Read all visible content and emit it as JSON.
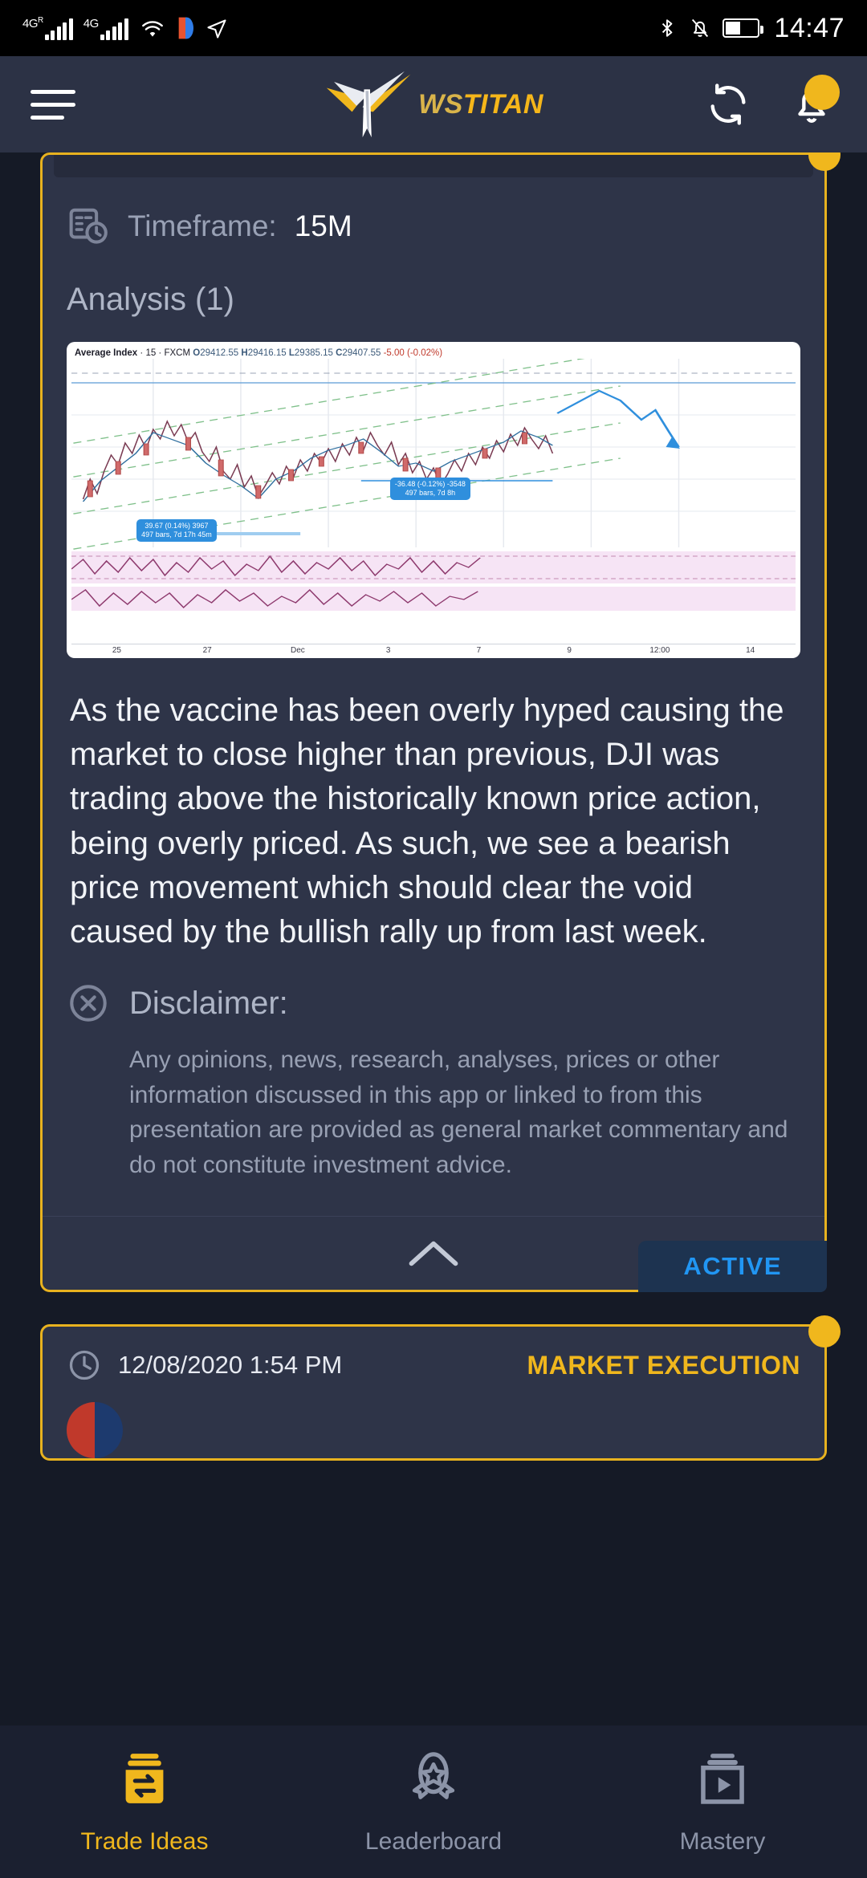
{
  "statusbar": {
    "network_primary": "4G",
    "network_primary_sup": "R",
    "network_secondary": "4G",
    "icons": [
      "wifi-icon",
      "app-icon",
      "location-icon",
      "bluetooth-icon",
      "mute-icon",
      "battery-icon"
    ],
    "time": "14:47"
  },
  "header": {
    "menu_icon": "hamburger-menu-icon",
    "brand_prefix": "WS",
    "brand_name": "TITAN",
    "refresh_icon": "refresh-icon",
    "notification_icon": "bell-icon",
    "accent_color": "#f0b71d"
  },
  "card": {
    "timeframe_label": "Timeframe:",
    "timeframe_value": "15M",
    "analysis_title": "Analysis (1)",
    "analysis_text": "As the vaccine has been overly hyped causing the market to close higher than previous, DJI was trading above the historically known price action, being overly priced. As such, we see a bearish price movement which should clear the void caused by the bullish rally up from last week.",
    "disclaimer_title": "Disclaimer:",
    "disclaimer_text": "Any opinions, news, research, analyses, prices or other information discussed in this app or linked to from this presentation are provided as general market commentary and do not constitute investment advice.",
    "collapse_icon": "chevron-up-icon",
    "status_badge": "ACTIVE",
    "status_color": "#2196f3"
  },
  "card2": {
    "clock_icon": "clock-icon",
    "timestamp": "12/08/2020 1:54 PM",
    "execution_label": "MARKET EXECUTION"
  },
  "chart_data": {
    "type": "line",
    "title": "Average Index",
    "interval": "15",
    "exchange": "FXCM",
    "quote": {
      "open_label": "O",
      "open": "29412.55",
      "high_label": "H",
      "high": "29416.15",
      "low_label": "L",
      "low": "29385.15",
      "close_label": "C",
      "close": "29407.55",
      "change": "-5.00",
      "change_pct": "(-0.02%)"
    },
    "xlabel": "",
    "ylabel": "",
    "grid": true,
    "legend": "none",
    "x_ticks": [
      "25",
      "27",
      "Dec",
      "3",
      "7",
      "9",
      "12:00",
      "14"
    ],
    "annotations": [
      {
        "line1": "39.67 (0.14%) 3967",
        "line2": "497 bars, 7d 17h 45m"
      },
      {
        "line1": "-36.48 (-0.12%) -3548",
        "line2": "497 bars, 7d 8h"
      }
    ],
    "series": [
      {
        "name": "price",
        "type": "candles",
        "values": [
          29060,
          29080,
          29110,
          29160,
          29140,
          29190,
          29240,
          29210,
          29260,
          29300,
          29340,
          29310,
          29270,
          29230,
          29190,
          29150,
          29120,
          29160,
          29200,
          29250,
          29230,
          29190,
          29150,
          29110,
          29080,
          29120,
          29170,
          29210,
          29260,
          29300,
          29280,
          29240,
          29200,
          29250,
          29300,
          29350,
          29390,
          29360,
          29320,
          29280,
          29330,
          29380,
          29420,
          29400,
          29370,
          29410,
          29440,
          29420,
          29400,
          29408
        ]
      },
      {
        "name": "forecast",
        "type": "projection",
        "values": [
          29440,
          29470,
          29500,
          29480,
          29440,
          29400,
          29370,
          29340,
          29310,
          29290
        ]
      }
    ]
  },
  "bottomnav": {
    "items": [
      {
        "label": "Trade Ideas",
        "icon": "trade-ideas-icon",
        "active": true
      },
      {
        "label": "Leaderboard",
        "icon": "leaderboard-rocket-icon",
        "active": false
      },
      {
        "label": "Mastery",
        "icon": "mastery-video-icon",
        "active": false
      }
    ]
  }
}
